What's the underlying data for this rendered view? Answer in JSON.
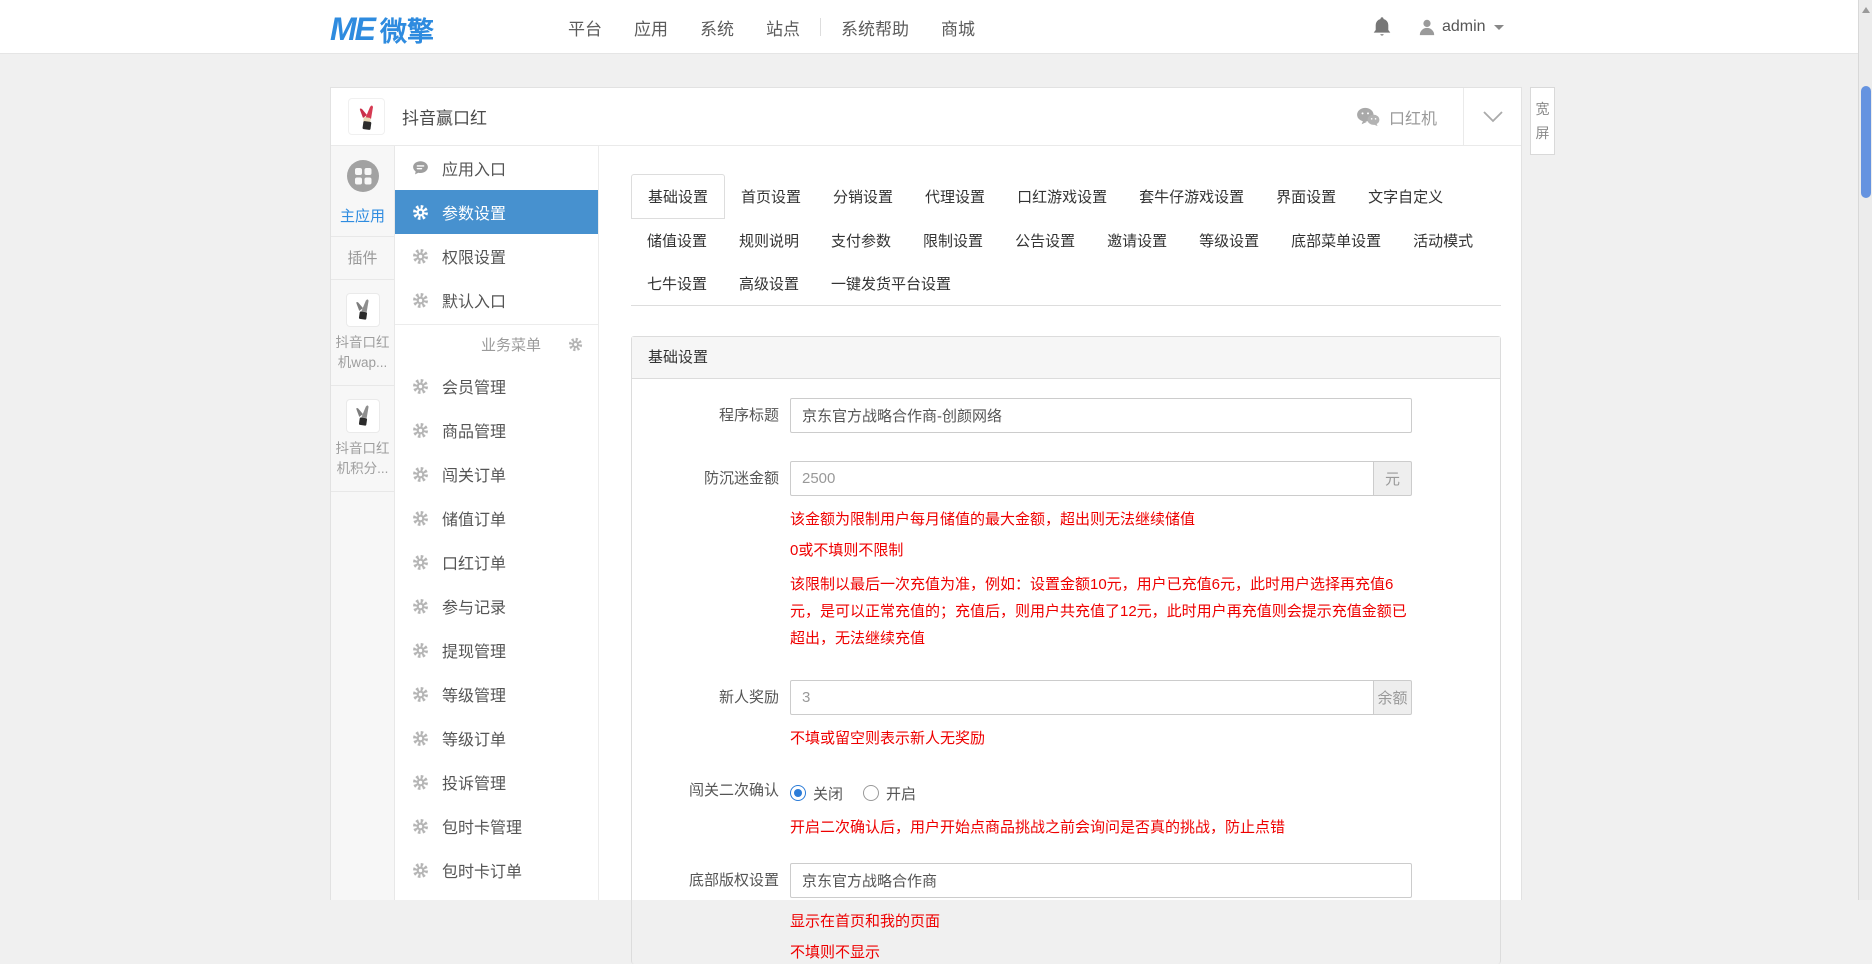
{
  "topbar": {
    "logo_mark": "ME",
    "logo_cn": "微擎",
    "nav": [
      "平台",
      "应用",
      "系统",
      "站点",
      "系统帮助",
      "商城"
    ],
    "username": "admin"
  },
  "widescreen_label": "宽屏",
  "app_header": {
    "title": "抖音赢口红",
    "account_label": "口红机"
  },
  "apps_bar": {
    "main_app_label": "主应用",
    "plugins_label": "插件",
    "plugins": [
      "抖音口红机wap...",
      "抖音口红机积分..."
    ]
  },
  "menu": {
    "items": [
      "应用入口",
      "参数设置",
      "权限设置",
      "默认入口"
    ],
    "active_item": "参数设置",
    "section_label": "业务菜单",
    "business_items": [
      "会员管理",
      "商品管理",
      "闯关订单",
      "储值订单",
      "口红订单",
      "参与记录",
      "提现管理",
      "等级管理",
      "等级订单",
      "投诉管理",
      "包时卡管理",
      "包时卡订单"
    ]
  },
  "tabs": {
    "active": "基础设置",
    "row1": [
      "基础设置",
      "首页设置",
      "分销设置",
      "代理设置",
      "口红游戏设置",
      "套牛仔游戏设置",
      "界面设置",
      "文字自定义"
    ],
    "row2": [
      "储值设置",
      "规则说明",
      "支付参数",
      "限制设置",
      "公告设置",
      "邀请设置",
      "等级设置",
      "底部菜单设置",
      "活动模式"
    ],
    "row3": [
      "七牛设置",
      "高级设置",
      "一键发货平台设置"
    ]
  },
  "panel": {
    "title": "基础设置",
    "program_title": {
      "label": "程序标题",
      "value": "京东官方战略合作商-创颜网络"
    },
    "anti_addiction": {
      "label": "防沉迷金额",
      "value": "2500",
      "addon": "元",
      "help1": "该金额为限制用户每月储值的最大金额，超出则无法继续储值",
      "help2": "0或不填则不限制",
      "help3": "该限制以最后一次充值为准，例如：设置金额10元，用户已充值6元，此时用户选择再充值6元，是可以正常充值的；充值后，则用户共充值了12元，此时用户再充值则会提示充值金额已超出，无法继续充值"
    },
    "newcomer_reward": {
      "label": "新人奖励",
      "value": "3",
      "addon": "余额",
      "help": "不填或留空则表示新人无奖励"
    },
    "second_confirm": {
      "label": "闯关二次确认",
      "option_close": "关闭",
      "option_open": "开启",
      "selected": "关闭",
      "help": "开启二次确认后，用户开始点商品挑战之前会询问是否真的挑战，防止点错"
    },
    "copyright": {
      "label": "底部版权设置",
      "value": "京东官方战略合作商",
      "help1": "显示在首页和我的页面",
      "help2": "不填则不显示"
    }
  },
  "colors": {
    "accent_blue": "#2f8ce0",
    "menu_active_bg": "#4791cf",
    "help_red": "#ee0000",
    "scroll_thumb_blue": "#6593e0"
  }
}
